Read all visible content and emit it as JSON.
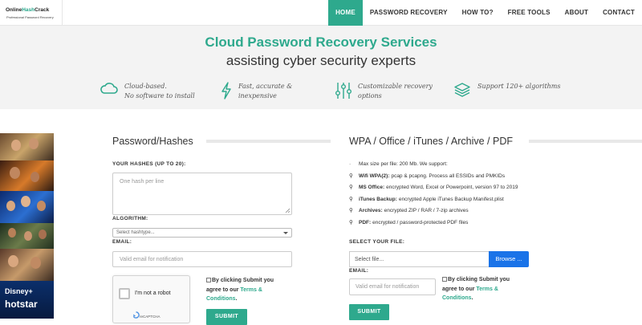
{
  "brand": {
    "name_part1": "Online",
    "name_part2": "Hash",
    "name_part3": "Crack",
    "tagline": "Professional Password Recovery"
  },
  "nav": {
    "items": [
      "HOME",
      "PASSWORD RECOVERY",
      "HOW TO?",
      "FREE TOOLS",
      "ABOUT",
      "CONTACT"
    ],
    "active": "HOME"
  },
  "hero": {
    "title": "Cloud Password Recovery Services",
    "subtitle": "assisting cyber security experts",
    "features": [
      {
        "icon": "cloud-icon",
        "line1": "Cloud-based.",
        "line2": "No software to install"
      },
      {
        "icon": "lightning-icon",
        "line1": "Fast, accurate &",
        "line2": "inexpensive"
      },
      {
        "icon": "sliders-icon",
        "line1": "Customizable recovery",
        "line2": "options"
      },
      {
        "icon": "layers-icon",
        "line1": "Support 120+ algorithms",
        "line2": ""
      }
    ]
  },
  "ad": {
    "brand_top": "Disney+",
    "brand_bottom": "hotstar"
  },
  "hashes": {
    "title": "Password/Hashes",
    "hashes_label": "YOUR HASHES (UP TO 20):",
    "hashes_placeholder": "One hash per line",
    "algorithm_label": "ALGORITHM:",
    "algorithm_placeholder": "Select hashtype...",
    "email_label": "EMAIL:",
    "email_placeholder": "Valid email for notification",
    "recaptcha_text": "I'm not a robot",
    "recaptcha_brand": "reCAPTCHA",
    "agree_prefix": "By clicking Submit you agree to our ",
    "agree_link": "Terms & Conditions",
    "agree_suffix": ".",
    "submit_label": "SUBMIT"
  },
  "wpa": {
    "title": "WPA / Office / iTunes / Archive / PDF",
    "support": [
      {
        "bold": "",
        "text": "Max size per file: 200 Mb. We support:"
      },
      {
        "bold": "Wifi WPA(2):",
        "text": "pcap & pcapng. Process all ESSIDs and PMKIDs"
      },
      {
        "bold": "MS Office:",
        "text": "encrypted Word, Excel or Powerpoint, version 97 to 2019"
      },
      {
        "bold": "iTunes Backup:",
        "text": "encrypted Apple iTunes Backup Manifest.plist"
      },
      {
        "bold": "Archives:",
        "text": "encrypted ZIP / RAR / 7-zip archives"
      },
      {
        "bold": "PDF:",
        "text": "encrypted / password-protected PDF files"
      }
    ],
    "file_label": "SELECT YOUR FILE:",
    "file_placeholder": "Select file...",
    "browse_label": "Browse ...",
    "email_label": "EMAIL:",
    "email_placeholder": "Valid email for notification",
    "agree_prefix": "By clicking Submit you agree to our ",
    "agree_link": "Terms & Conditions",
    "agree_suffix": ".",
    "submit_label": "SUBMIT"
  },
  "colors": {
    "accent": "#2ea98d",
    "browse": "#1a73e8",
    "hero_bg": "#f3f3f3"
  }
}
